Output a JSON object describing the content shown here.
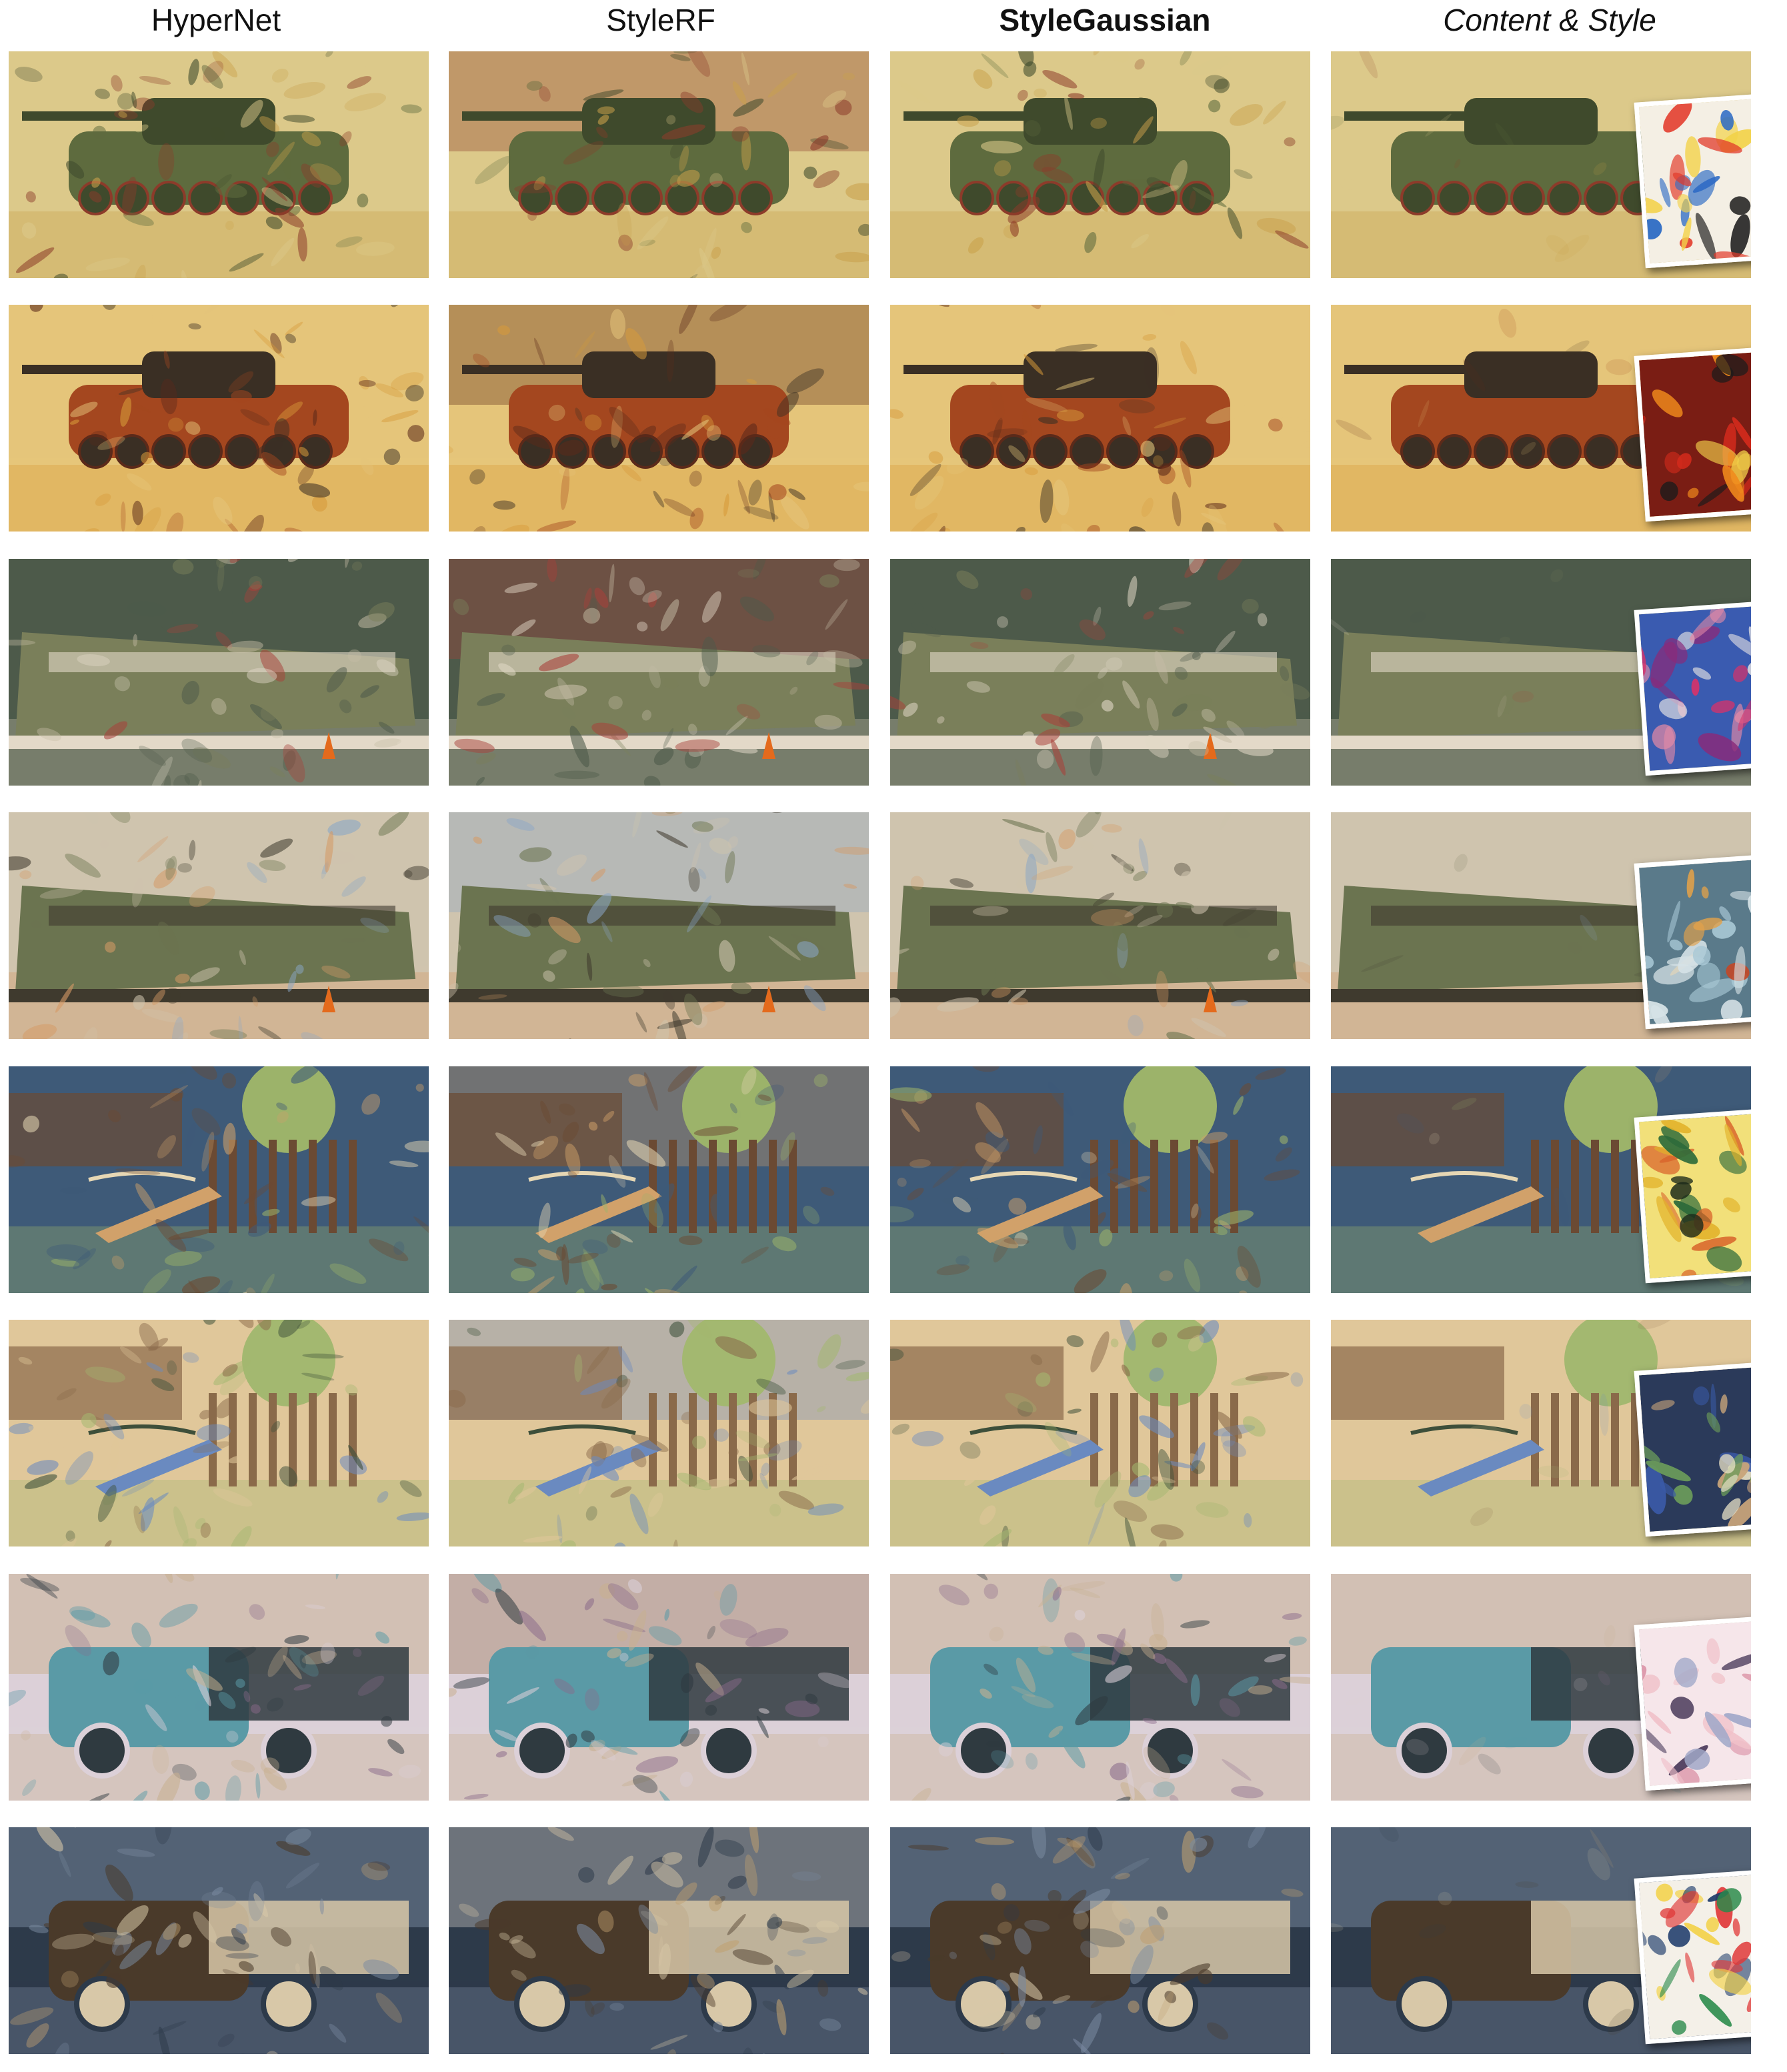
{
  "columns": [
    {
      "label": "HyperNet"
    },
    {
      "label": "StyleRF"
    },
    {
      "label": "StyleGaussian"
    },
    {
      "label": "Content & Style"
    }
  ],
  "rows": [
    {
      "scene": "tank-side",
      "palette": [
        "#5e6b3e",
        "#c9a04a",
        "#8c3b2a",
        "#dcc98a",
        "#3f4a2c"
      ],
      "style_palette": [
        "#e23a2a",
        "#2d6bc4",
        "#f2d24a",
        "#1c1c1c",
        "#f4efe4"
      ]
    },
    {
      "scene": "tank-front",
      "palette": [
        "#a4471f",
        "#d79a3a",
        "#5b2a1a",
        "#e5c57a",
        "#3a2f24"
      ],
      "style_palette": [
        "#d32a1c",
        "#f08a1c",
        "#1b1b1b",
        "#f2d04a",
        "#7a1d14"
      ]
    },
    {
      "scene": "train-side",
      "palette": [
        "#7a7f5a",
        "#c8bfa8",
        "#a8413a",
        "#4d5a4a",
        "#e3d9c8"
      ],
      "style_palette": [
        "#f4efe8",
        "#d6326a",
        "#8a2a7a",
        "#e48aa6",
        "#3a5bb0"
      ]
    },
    {
      "scene": "train-angle",
      "palette": [
        "#6b7450",
        "#d59a66",
        "#8aa6c6",
        "#cfc4ae",
        "#3f3a2e"
      ],
      "style_palette": [
        "#a9c9d6",
        "#d6e2e6",
        "#c0492a",
        "#e2a14a",
        "#5a7a8a"
      ]
    },
    {
      "scene": "playground",
      "palette": [
        "#6b4a33",
        "#9cb36a",
        "#d1a16a",
        "#3e5a78",
        "#e6d7b4"
      ],
      "style_palette": [
        "#2d6a3a",
        "#e2b22a",
        "#d8632a",
        "#1c2a1a",
        "#f2e07a"
      ]
    },
    {
      "scene": "swings",
      "palette": [
        "#8a6a4a",
        "#a3b870",
        "#6a8ac0",
        "#e0c79a",
        "#3d4f3a"
      ],
      "style_palette": [
        "#3a5aa8",
        "#e6dfc4",
        "#6a9a5a",
        "#c8a47a",
        "#2b3a5a"
      ]
    },
    {
      "scene": "truck-blue",
      "palette": [
        "#5a9aa6",
        "#c8b090",
        "#8a6a8a",
        "#dcd0d8",
        "#2f3a40"
      ],
      "style_palette": [
        "#f0c0c8",
        "#d88aa0",
        "#4a3a5a",
        "#a0a8c8",
        "#f6e6ea"
      ]
    },
    {
      "scene": "truck-flatbed",
      "palette": [
        "#4a3a2a",
        "#7a8aa0",
        "#c0a070",
        "#2d3a4a",
        "#d8c8a8"
      ],
      "style_palette": [
        "#1c3a6a",
        "#e03a3a",
        "#f2d24a",
        "#2a8a4a",
        "#f4f0e8"
      ]
    }
  ]
}
